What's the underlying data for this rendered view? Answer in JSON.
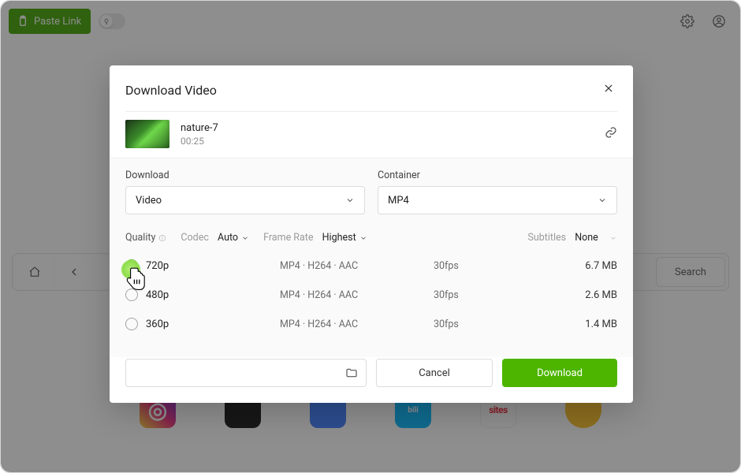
{
  "topbar": {
    "paste_label": "Paste Link"
  },
  "browse": {
    "search_label": "Search"
  },
  "modal": {
    "title": "Download Video",
    "video": {
      "name": "nature-7",
      "duration": "00:25"
    },
    "download_label": "Download",
    "container_label": "Container",
    "download_type": "Video",
    "container_value": "MP4",
    "filters": {
      "quality_label": "Quality",
      "codec_label": "Codec",
      "codec_value": "Auto",
      "fps_label": "Frame Rate",
      "fps_value": "Highest",
      "subs_label": "Subtitles",
      "subs_value": "None"
    },
    "qualities": [
      {
        "res": "720p",
        "fmt": "MP4 · H264 · AAC",
        "fps": "30fps",
        "size": "6.7 MB",
        "selected": true
      },
      {
        "res": "480p",
        "fmt": "MP4 · H264 · AAC",
        "fps": "30fps",
        "size": "2.6 MB",
        "selected": false
      },
      {
        "res": "360p",
        "fmt": "MP4 · H264 · AAC",
        "fps": "30fps",
        "size": "1.4 MB",
        "selected": false
      }
    ],
    "buttons": {
      "cancel": "Cancel",
      "download": "Download"
    }
  }
}
